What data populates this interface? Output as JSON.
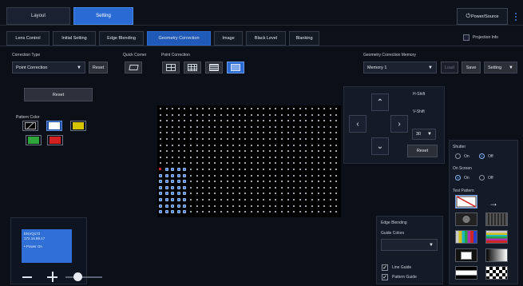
{
  "top": {
    "tabs": [
      {
        "label": "Layout",
        "active": false
      },
      {
        "label": "Setting",
        "active": true
      }
    ],
    "power_label": "Power/Source",
    "menu_icon": "kebab-icon"
  },
  "subtabs": [
    {
      "label": "Lens Control",
      "active": false
    },
    {
      "label": "Initial Setting",
      "active": false
    },
    {
      "label": "Edge Blending",
      "active": false
    },
    {
      "label": "Geometry Correction",
      "active": true
    },
    {
      "label": "Image",
      "active": false
    },
    {
      "label": "Black Level",
      "active": false
    },
    {
      "label": "Blanking",
      "active": false
    }
  ],
  "projection_info_label": "Projection Info",
  "correction": {
    "type_label": "Correction Type",
    "type_value": "Point Correction",
    "reset_label": "Reset",
    "quick_corner_label": "Quick Corner",
    "point_correction_label": "Point Correction"
  },
  "memory": {
    "label": "Geometry Correction Memory",
    "value": "Memory 1",
    "load_label": "Load",
    "save_label": "Save",
    "setting_label": "Setting"
  },
  "left": {
    "reset_label": "Reset",
    "pattern_color_label": "Pattern Color",
    "colors": [
      "#000000",
      "#ffffff",
      "#d6c400",
      "#2fa53a",
      "#d32020"
    ],
    "preview_lines": [
      "ENVQ172",
      "172.16.88.17",
      "• Power On"
    ]
  },
  "shift": {
    "h_label": "H-Shift",
    "v_label": "V-Shift",
    "step_value": "30",
    "reset_label": "Reset"
  },
  "right": {
    "shutter_label": "Shutter",
    "shutter_on": "On",
    "shutter_off": "Off",
    "shutter_value": "Off",
    "onscreen_label": "On Screen",
    "onscreen_on": "On",
    "onscreen_off": "Off",
    "onscreen_value": "On",
    "test_pattern_label": "Test Pattern"
  },
  "edge": {
    "title": "Edge Blending",
    "guide_colors_label": "Guide Colors",
    "line_guide_label": "Line Guide",
    "pattern_guide_label": "Pattern Guide",
    "line_guide_checked": true,
    "pattern_guide_checked": true
  }
}
